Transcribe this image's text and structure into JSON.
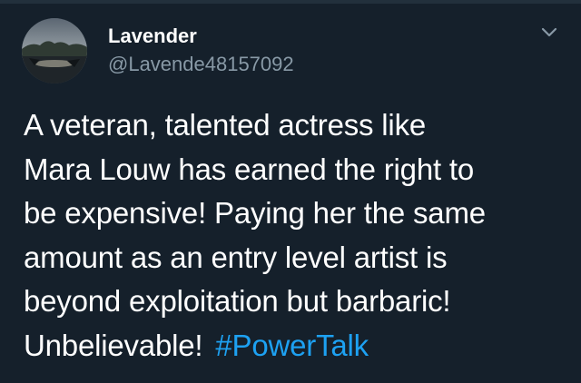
{
  "tweet": {
    "author": {
      "display_name": "Lavender",
      "handle": "@Lavende48157092"
    },
    "text_lines": [
      "A veteran, talented actress like",
      "Mara Louw has earned the right to",
      "be expensive! Paying her the same",
      "amount as an entry level artist is",
      "beyond exploitation but barbaric!",
      "Unbelievable!"
    ],
    "hashtag": "#PowerTalk"
  },
  "icons": {
    "menu": "chevron-down-icon",
    "avatar": "avatar-photo"
  },
  "colors": {
    "background": "#15202b",
    "text": "#ffffff",
    "secondary_text": "#8899a6",
    "link": "#1da1f2"
  }
}
